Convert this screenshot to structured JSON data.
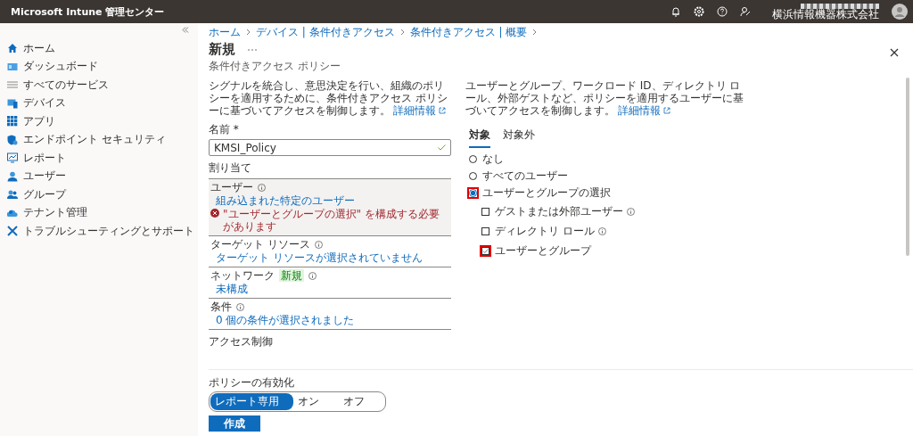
{
  "topbar": {
    "title": "Microsoft Intune 管理センター",
    "org": "横浜情報機器株式会社"
  },
  "sidebar": {
    "items": [
      {
        "label": "ホーム"
      },
      {
        "label": "ダッシュボード"
      },
      {
        "label": "すべてのサービス"
      },
      {
        "label": "デバイス"
      },
      {
        "label": "アプリ"
      },
      {
        "label": "エンドポイント セキュリティ"
      },
      {
        "label": "レポート"
      },
      {
        "label": "ユーザー"
      },
      {
        "label": "グループ"
      },
      {
        "label": "テナント管理"
      },
      {
        "label": "トラブルシューティングとサポート"
      }
    ]
  },
  "breadcrumb": [
    "ホーム",
    "デバイス | 条件付きアクセス",
    "条件付きアクセス | 概要"
  ],
  "page": {
    "title": "新規",
    "subtitle": "条件付きアクセス ポリシー"
  },
  "left": {
    "intro": "シグナルを統合し、意思決定を行い、組織のポリシーを適用するために、条件付きアクセス ポリシーに基づいてアクセスを制御します。",
    "intro_link": "詳細情報",
    "name_label": "名前 *",
    "name_value": "KMSI_Policy",
    "assign_heading": "割り当て",
    "sections": [
      {
        "label": "ユーザー",
        "value": "組み込まれた特定のユーザー",
        "error": "\"ユーザーとグループの選択\" を構成する必要があります",
        "highlighted": true
      },
      {
        "label": "ターゲット リソース",
        "value": "ターゲット リソースが選択されていません",
        "highlighted": false
      },
      {
        "label": "ネットワーク",
        "badge": "新規",
        "value": "未構成",
        "highlighted": false
      },
      {
        "label": "条件",
        "value": "0 個の条件が選択されました",
        "highlighted": false
      }
    ],
    "access_heading": "アクセス制御"
  },
  "right": {
    "intro": "ユーザーとグループ、ワークロード ID、ディレクトリ ロール、外部ゲストなど、ポリシーを適用するユーザーに基づいてアクセスを制御します。",
    "intro_link": "詳細情報",
    "tabs": [
      {
        "label": "対象",
        "selected": true
      },
      {
        "label": "対象外",
        "selected": false
      }
    ],
    "radios": [
      {
        "label": "なし",
        "selected": false,
        "highlighted": false
      },
      {
        "label": "すべてのユーザー",
        "selected": false,
        "highlighted": false
      },
      {
        "label": "ユーザーとグループの選択",
        "selected": true,
        "highlighted": true
      }
    ],
    "checkboxes": [
      {
        "label": "ゲストまたは外部ユーザー",
        "checked": false,
        "info": true,
        "highlighted": false
      },
      {
        "label": "ディレクトリ ロール",
        "checked": false,
        "info": true,
        "highlighted": false
      },
      {
        "label": "ユーザーとグループ",
        "checked": true,
        "info": false,
        "highlighted": true
      }
    ]
  },
  "footer": {
    "enable_label": "ポリシーの有効化",
    "options": [
      {
        "label": "レポート専用",
        "selected": true
      },
      {
        "label": "オン",
        "selected": false
      },
      {
        "label": "オフ",
        "selected": false
      }
    ],
    "create_button": "作成"
  }
}
